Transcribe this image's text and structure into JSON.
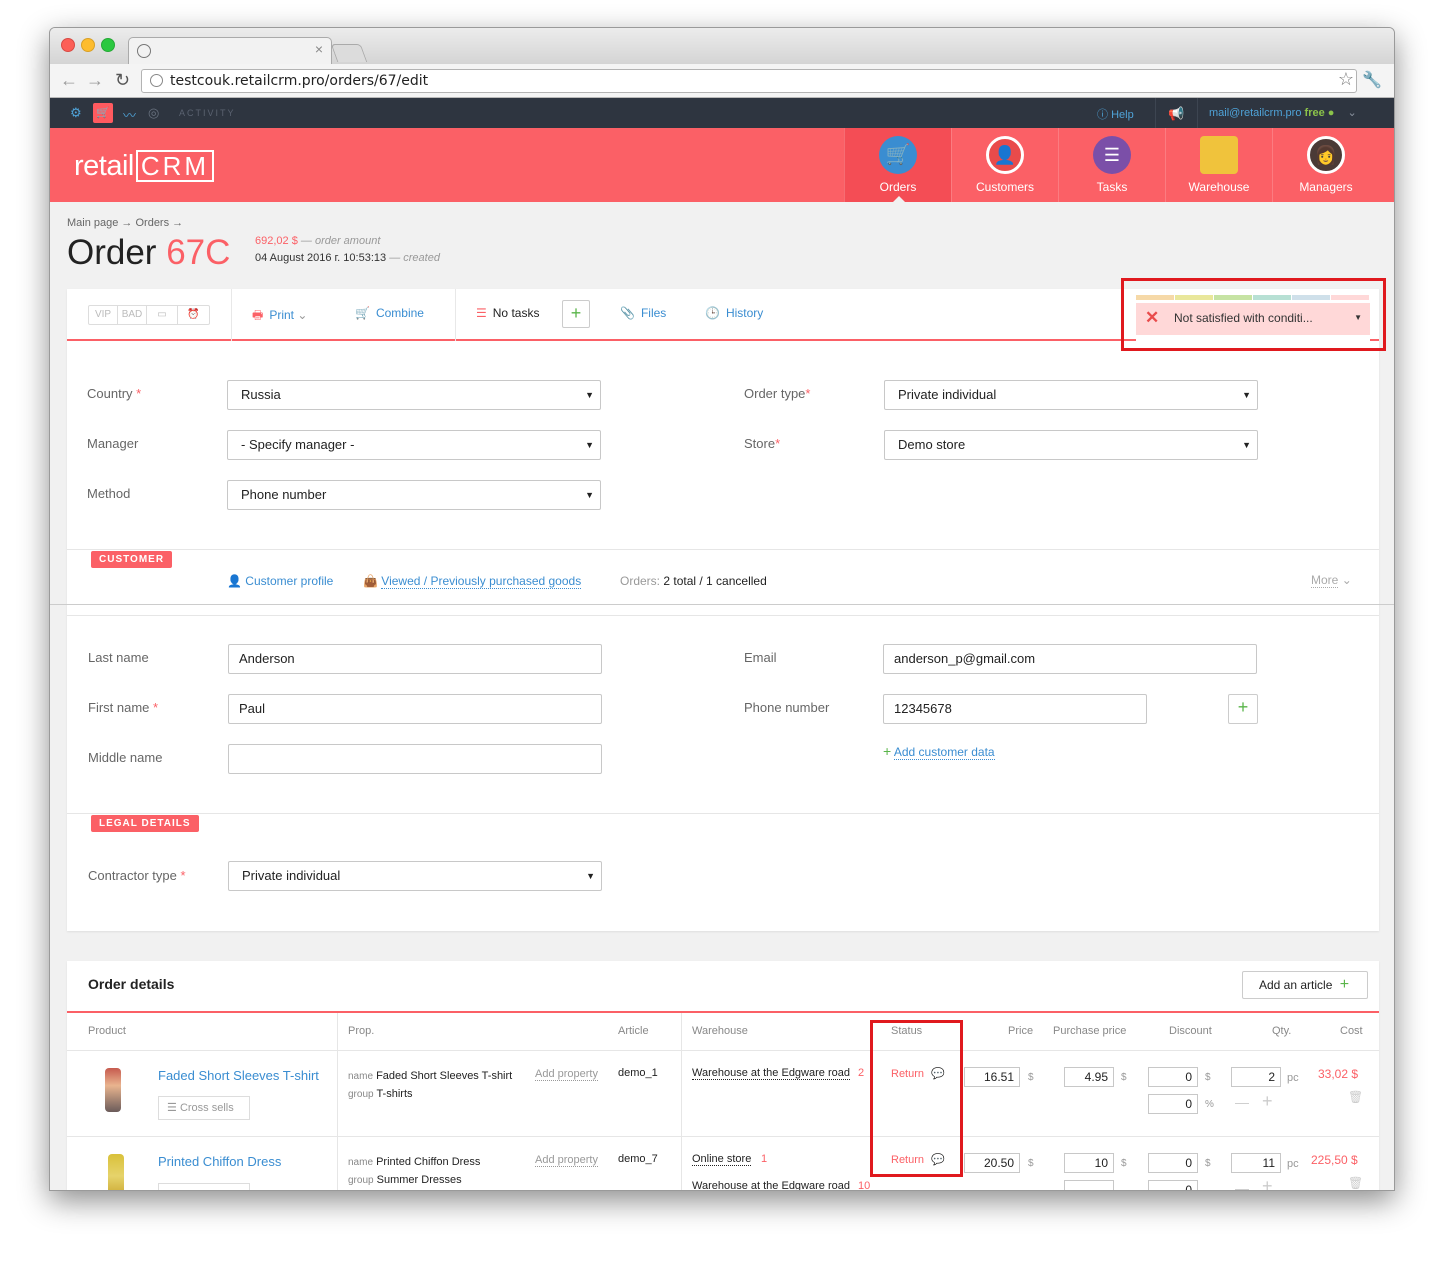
{
  "browser": {
    "url": "testcouk.retailcrm.pro/orders/67/edit",
    "tab_close": "×"
  },
  "appbar": {
    "activity": "ACTIVITY",
    "help": "Help",
    "email": "mail@retailcrm.pro",
    "plan": "free"
  },
  "logo": {
    "brand": "retail",
    "crm": "CRM"
  },
  "modules": [
    {
      "label": "Orders"
    },
    {
      "label": "Customers"
    },
    {
      "label": "Tasks"
    },
    {
      "label": "Warehouse"
    },
    {
      "label": "Managers"
    }
  ],
  "breadcrumb": "Main page → Orders →",
  "order": {
    "title": "Order",
    "number": "67C",
    "amount": "692,02 $",
    "amount_note": "— order amount",
    "created": "04 August 2016 г. 10:53:13",
    "created_note": "— created"
  },
  "actions": {
    "vip": "VIP",
    "bad": "BAD",
    "print": "Print",
    "combine": "Combine",
    "tasks": "No tasks",
    "files": "Files",
    "history": "History",
    "status_value": "Not satisfied with conditi..."
  },
  "form": {
    "country_label": "Country",
    "country_value": "Russia",
    "manager_label": "Manager",
    "manager_value": "- Specify manager -",
    "method_label": "Method",
    "method_value": "Phone number",
    "order_type_label": "Order type",
    "order_type_value": "Private individual",
    "store_label": "Store",
    "store_value": "Demo store"
  },
  "customer": {
    "section": "CUSTOMER",
    "profile_link": "Customer profile",
    "viewed_link": "Viewed / Previously purchased goods",
    "orders_label": "Orders:",
    "orders_value": "2 total / 1 cancelled",
    "more": "More",
    "last_name_label": "Last name",
    "last_name": "Anderson",
    "first_name_label": "First name",
    "first_name": "Paul",
    "middle_name_label": "Middle name",
    "middle_name": "",
    "email_label": "Email",
    "email": "anderson_p@gmail.com",
    "phone_label": "Phone number",
    "phone": "12345678",
    "add_data": "Add customer data"
  },
  "legal": {
    "section": "LEGAL DETAILS",
    "contractor_label": "Contractor type",
    "contractor_value": "Private individual"
  },
  "details": {
    "title": "Order details",
    "add_article": "Add an article",
    "columns": [
      "Product",
      "Prop.",
      "Article",
      "Warehouse",
      "Status",
      "Price",
      "Purchase price",
      "Discount",
      "Qty.",
      "Cost"
    ],
    "rows": [
      {
        "product": "Faded Short Sleeves T-shirt",
        "cross_sells": "Cross sells",
        "prop_name_label": "name",
        "prop_name": "Faded Short Sleeves T-shirt",
        "prop_group_label": "group",
        "prop_group": "T-shirts",
        "add_property": "Add property",
        "article": "demo_1",
        "warehouse": "Warehouse at the Edgware road",
        "warehouse_qty": "2",
        "status": "Return",
        "price": "16.51",
        "purchase": "4.95",
        "discount": "0",
        "discount_pct": "0",
        "qty": "2",
        "qty_unit": "pc",
        "cost": "33,02 $"
      },
      {
        "product": "Printed Chiffon Dress",
        "prop_name_label": "name",
        "prop_name": "Printed Chiffon Dress",
        "prop_group_label": "group",
        "prop_group": "Summer Dresses",
        "add_property": "Add property",
        "article": "demo_7",
        "warehouse": "Online store",
        "warehouse_qty": "1",
        "warehouse2": "Warehouse at the Edgware road",
        "warehouse2_qty": "10",
        "status": "Return",
        "price": "20.50",
        "purchase": "10",
        "discount": "0",
        "discount_pct": "0",
        "qty": "11",
        "qty_unit": "pc",
        "cost": "225,50 $"
      }
    ],
    "currency": "$",
    "percent": "%"
  }
}
